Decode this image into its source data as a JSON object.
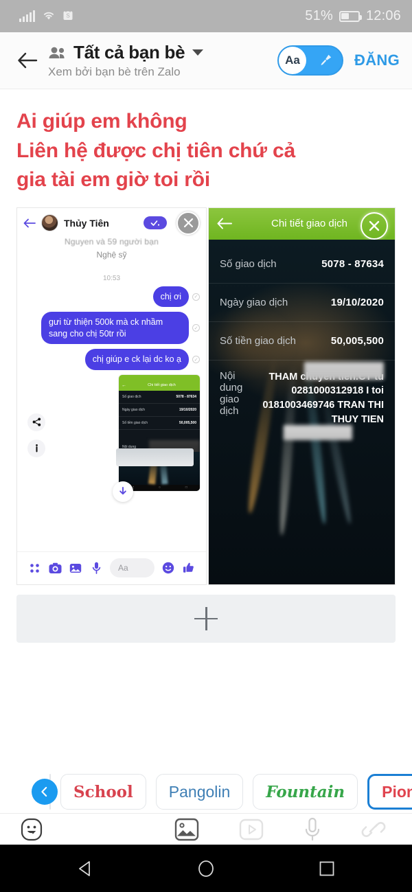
{
  "status_bar": {
    "battery_percent": "51%",
    "time": "12:06",
    "icons": [
      "signal-bars-icon",
      "wifi-icon",
      "shopping-bag-icon",
      "battery-icon"
    ]
  },
  "header": {
    "back_icon": "back-arrow-icon",
    "audience_icon": "people-icon",
    "audience": "Tất cả bạn bè",
    "caret_icon": "chevron-down-icon",
    "subtitle": "Xem bởi bạn bè trên Zalo",
    "toggle": {
      "text_label": "Aa",
      "brush_icon": "paintbrush-icon",
      "state": "on",
      "accent": "#35a5f5"
    },
    "post_label": "ĐĂNG",
    "post_color": "#2e9ae6"
  },
  "composer": {
    "headline_color": "#e3434c",
    "headline_lines": [
      "Ai giúp em không",
      "Liên hệ được chị tiên chứ cả",
      "gia tài em giờ toi rồi"
    ],
    "add_media": {
      "icon": "plus-icon",
      "label": ""
    }
  },
  "attachment_left": {
    "app": "messenger-chat-screenshot",
    "back_icon": "back-arrow-icon",
    "avatar": "contact-avatar",
    "contact_name": "Thủy Tiên",
    "verified_badge_icon": "check-badge-icon",
    "close_icon": "close-icon",
    "profile_line_1": "Nguyen và 59 người bạn",
    "profile_line_2": "Nghệ sỹ",
    "timestamp": "10:53",
    "messages": [
      {
        "text": "chị ơi",
        "from": "me",
        "status_icon": "sent-check-icon"
      },
      {
        "text": "gưi từ thiện 500k mà ck nhầm sang cho chị 50tr rồi",
        "from": "me",
        "status_icon": "sent-check-icon"
      },
      {
        "text": "chị giúp e ck lại dc ko ạ",
        "from": "me",
        "status_icon": "sent-check-icon"
      }
    ],
    "attachment_actions": [
      "share-icon",
      "info-icon"
    ],
    "download_icon": "download-icon",
    "nested_thumbnail": {
      "header_title": "Chi tiết giao dịch",
      "rows": [
        {
          "key": "Số giao dịch",
          "value": "5078 - 87634"
        },
        {
          "key": "Ngày giao dịch",
          "value": "19/10/2020"
        },
        {
          "key": "Số tiền giao dịch",
          "value": "50,005,500"
        }
      ],
      "note_key": "Nội dung"
    },
    "toolbar": {
      "icons": [
        "apps-grid-icon",
        "camera-icon",
        "gallery-icon",
        "microphone-icon"
      ],
      "input_placeholder": "Aa",
      "emoji_icon": "emoji-icon",
      "like_icon": "thumbs-up-icon"
    },
    "bubble_color": "#4b3fe4"
  },
  "attachment_right": {
    "app": "bank-transaction-detail-screenshot",
    "header_color": "#7fbf26",
    "back_icon": "back-arrow-icon",
    "title": "Chi tiết giao dịch",
    "close_icon": "close-icon",
    "rows": [
      {
        "key": "Số giao dịch",
        "value": "5078 - 87634"
      },
      {
        "key": "Ngày giao dịch",
        "value": "19/10/2020"
      },
      {
        "key": "Số tiền giao dịch",
        "value": "50,005,500"
      }
    ],
    "note_key": "Nội dung giao dịch",
    "note_value": "THAM chuyen tien.CT tu 0281000312918 I toi 0181003469746 TRAN THI THUY TIEN"
  },
  "font_chips": {
    "prev_icon": "chevron-left-icon",
    "partial_label": "/",
    "items": [
      {
        "label": "School",
        "color": "#d8434f",
        "selected": false
      },
      {
        "label": "Pangolin",
        "color": "#3f7fb5",
        "selected": false
      },
      {
        "label": "Fountain",
        "color": "#37a64a",
        "selected": false
      },
      {
        "label": "Pioneer",
        "color": "#e0444f",
        "selected": true
      }
    ],
    "selected_border": "#1b7fd4"
  },
  "bottom_toolbar": {
    "items": [
      {
        "icon": "sticker-icon",
        "enabled": true
      },
      {
        "icon": "photo-icon",
        "enabled": true
      },
      {
        "icon": "video-icon",
        "enabled": false
      },
      {
        "icon": "microphone-icon",
        "enabled": false
      },
      {
        "icon": "link-icon",
        "enabled": false
      }
    ]
  },
  "nav_bar": {
    "back_icon": "android-back-icon",
    "home_icon": "android-home-icon",
    "recents_icon": "android-recents-icon"
  }
}
